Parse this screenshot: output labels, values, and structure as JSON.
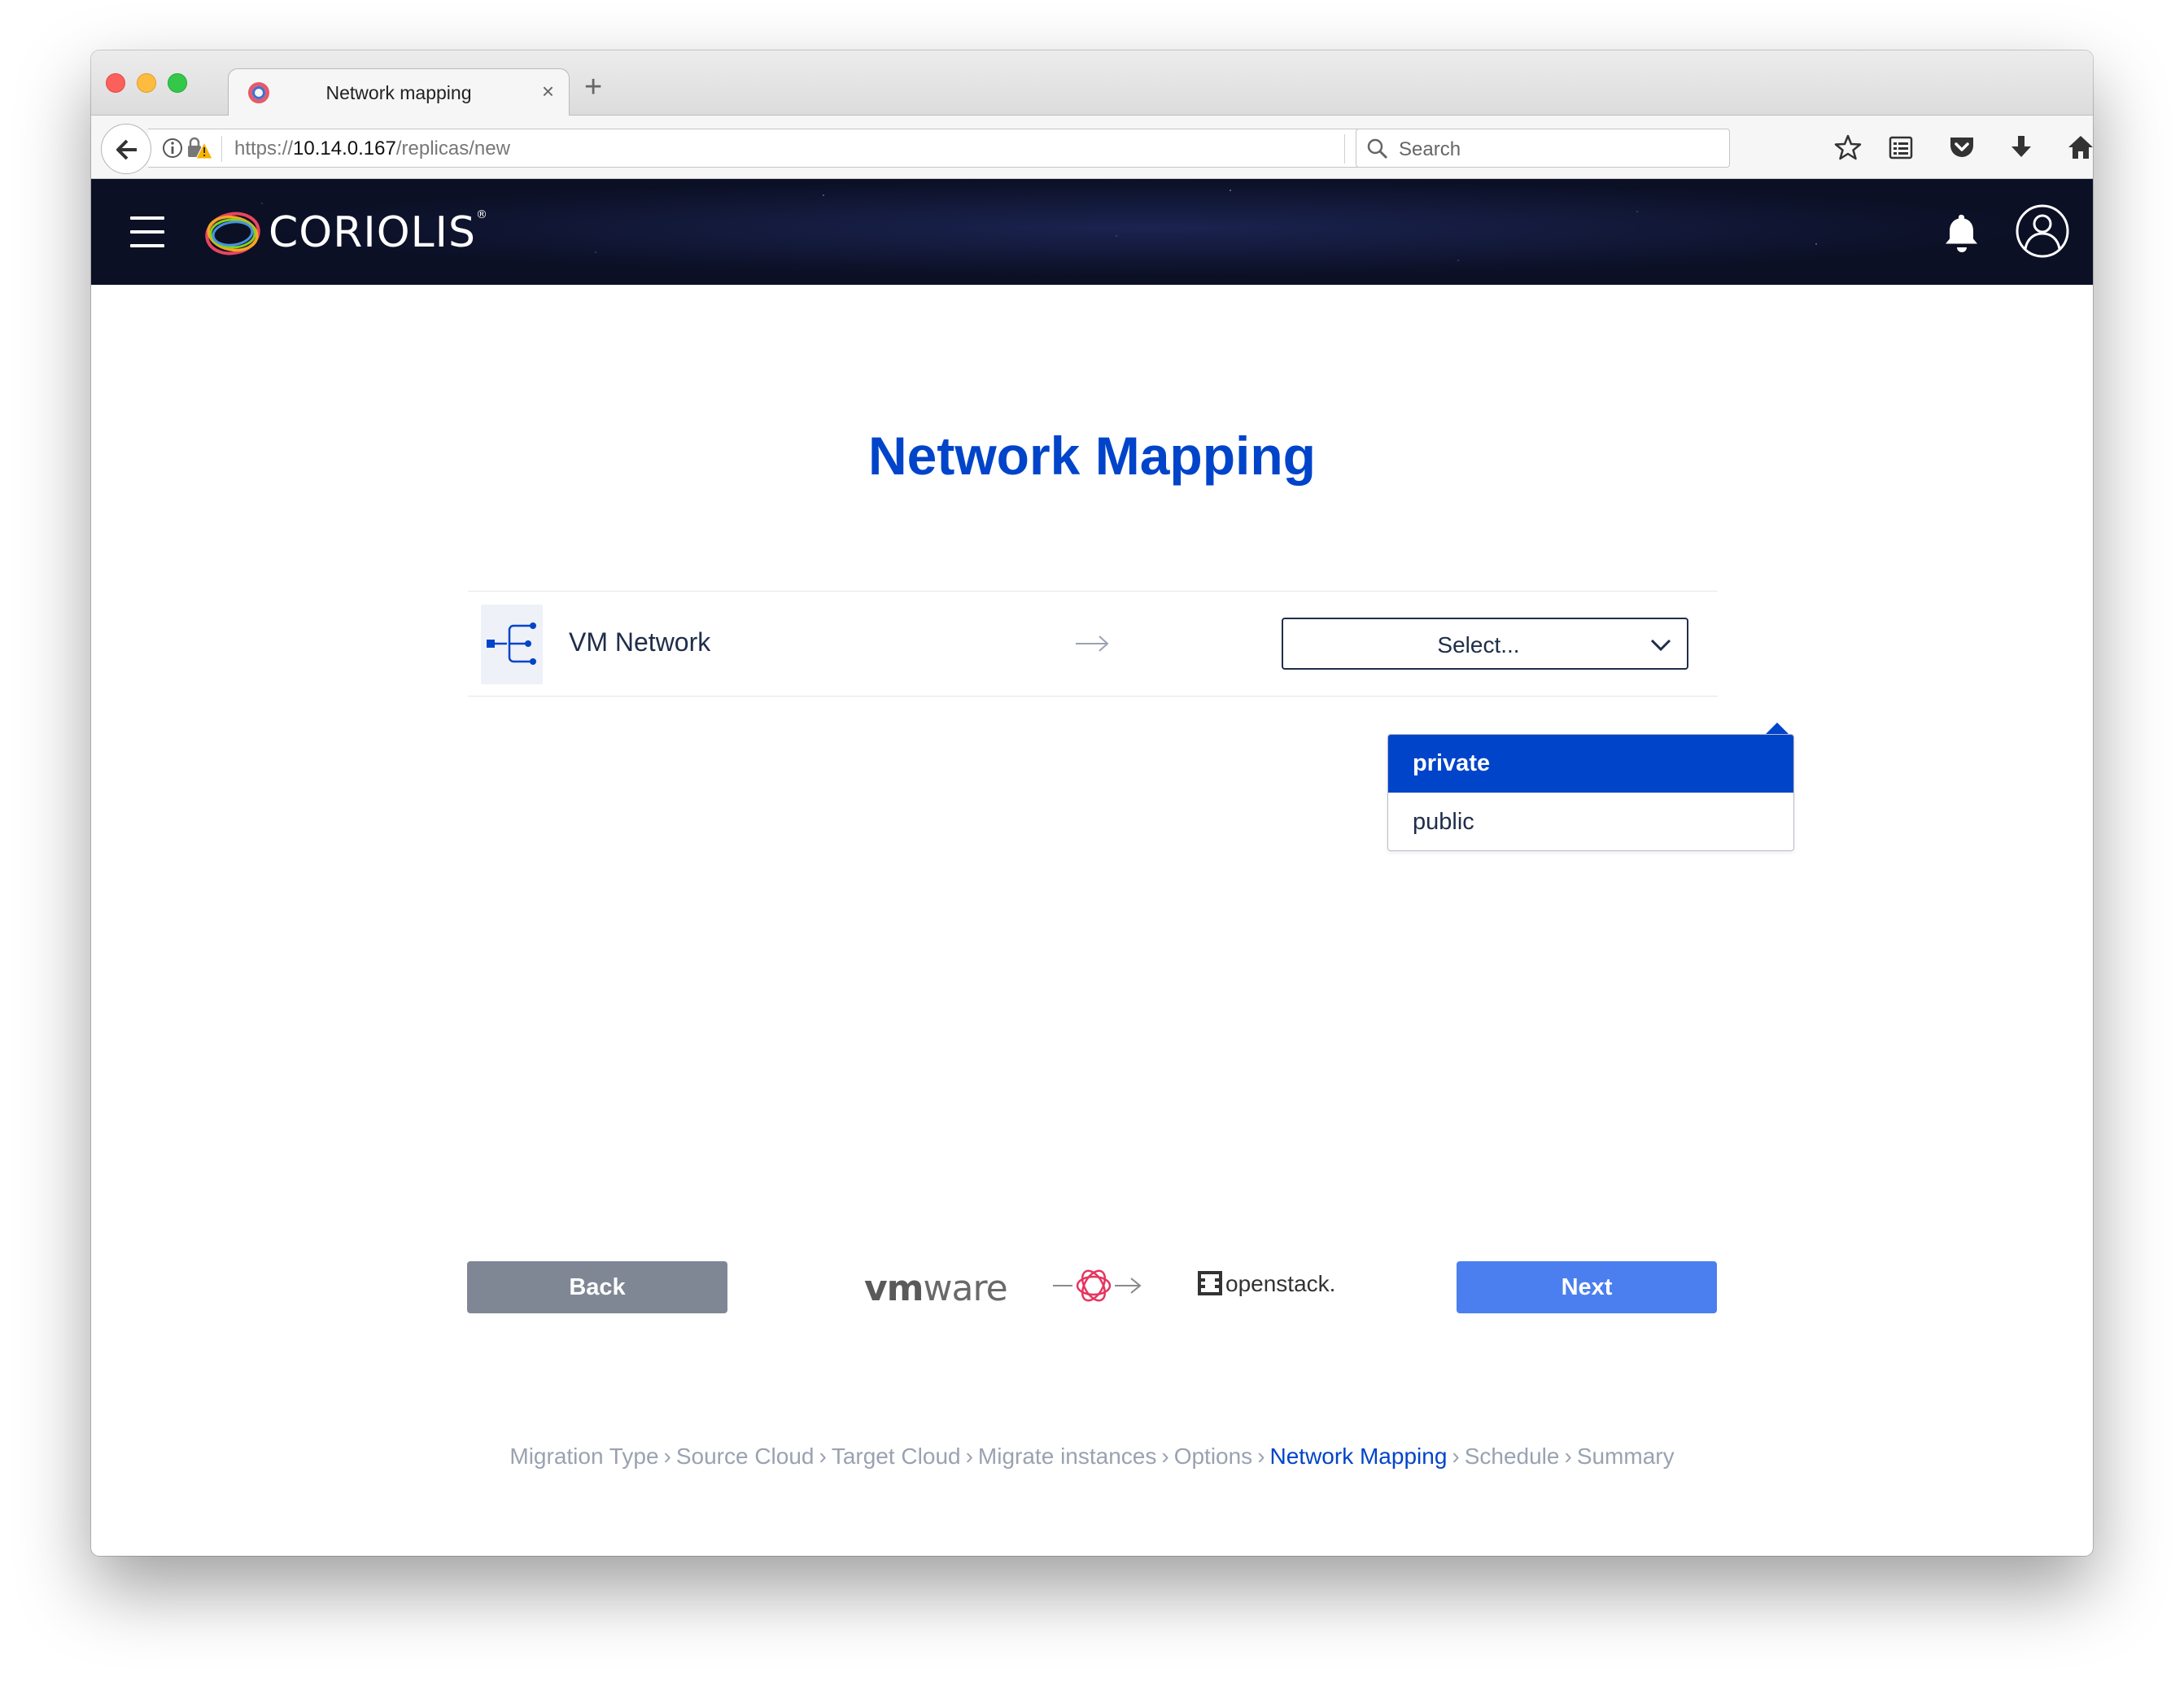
{
  "browser": {
    "tab_title": "Network mapping",
    "tab_close": "×",
    "new_tab": "+",
    "url_scheme": "https://",
    "url_host": "10.14.0.167",
    "url_path": "/replicas/new",
    "search_placeholder": "Search"
  },
  "app": {
    "brand": "CORIOLIS",
    "brand_mark": "®"
  },
  "page": {
    "title": "Network Mapping"
  },
  "mapping": {
    "source_network": "VM Network",
    "select_placeholder": "Select...",
    "options": [
      "private",
      "public"
    ],
    "highlighted_option": "private"
  },
  "footer": {
    "back_label": "Back",
    "next_label": "Next",
    "source_cloud_logo": {
      "prefix": "vm",
      "suffix": "ware"
    },
    "target_cloud_logo": "openstack."
  },
  "wizard": {
    "steps": [
      {
        "label": "Migration Type",
        "active": false
      },
      {
        "label": "Source Cloud",
        "active": false
      },
      {
        "label": "Target Cloud",
        "active": false
      },
      {
        "label": "Migrate instances",
        "active": false
      },
      {
        "label": "Options",
        "active": false
      },
      {
        "label": "Network Mapping",
        "active": true
      },
      {
        "label": "Schedule",
        "active": false
      },
      {
        "label": "Summary",
        "active": false
      }
    ],
    "separator": "›"
  },
  "colors": {
    "accent": "#0044ca",
    "next_button": "#4b7ff0",
    "back_button": "#7f8795",
    "header_bg": "#0b1025"
  },
  "icons": {
    "back": "arrow-left-icon",
    "info": "info-icon",
    "insecure": "warning-lock-icon",
    "reload": "reload-icon",
    "search": "search-icon",
    "bookmark": "star-icon",
    "reading_list": "reading-list-icon",
    "pocket": "pocket-icon",
    "downloads": "download-icon",
    "home": "home-icon",
    "menu": "hamburger-icon",
    "notifications": "bell-icon",
    "user": "user-icon",
    "network": "network-icon"
  }
}
